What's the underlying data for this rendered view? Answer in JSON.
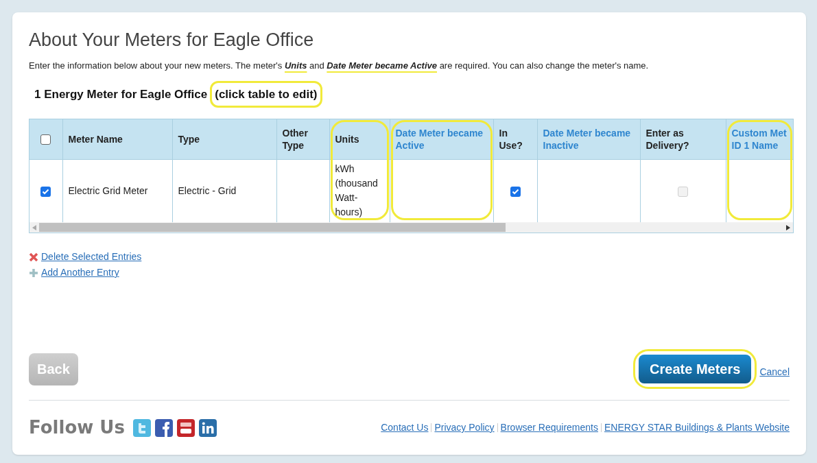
{
  "title": "About Your Meters for Eagle Office",
  "intro": "Enter the information below about your new meters. The meter's **Units** and **Date Meter became Active** are required. You can also change the meter's name.",
  "subtitle": {
    "text": "1 Energy Meter for Eagle Office",
    "note": "(click table to edit)",
    "note_highlighted": true
  },
  "table": {
    "select_all_checked": false,
    "columns": [
      {
        "label": "Meter Name",
        "link": false,
        "highlighted": false
      },
      {
        "label": "Type",
        "link": false,
        "highlighted": false
      },
      {
        "label": "Other Type",
        "link": false,
        "highlighted": false
      },
      {
        "label": "Units",
        "link": false,
        "highlighted": true
      },
      {
        "label": "Date Meter became Active",
        "link": true,
        "highlighted": true
      },
      {
        "label": "In Use?",
        "link": false,
        "highlighted": false
      },
      {
        "label": "Date Meter became Inactive",
        "link": true,
        "highlighted": false
      },
      {
        "label": "Enter as Delivery?",
        "link": false,
        "highlighted": false
      },
      {
        "label": "Custom Met ID 1 Name",
        "link": true,
        "highlighted": true
      }
    ],
    "rows": [
      {
        "selected": true,
        "cells": [
          {
            "kind": "text",
            "text": "Electric Grid Meter"
          },
          {
            "kind": "text",
            "text": "Electric - Grid"
          },
          {
            "kind": "empty"
          },
          {
            "kind": "text",
            "text": "kWh (thousand Watt-hours)"
          },
          {
            "kind": "empty"
          },
          {
            "kind": "checkbox",
            "checked": true,
            "disabled": false
          },
          {
            "kind": "empty"
          },
          {
            "kind": "checkbox",
            "checked": false,
            "disabled": true
          },
          {
            "kind": "empty"
          }
        ]
      }
    ]
  },
  "actions": [
    {
      "kind": "delete",
      "label": "Delete Selected Entries"
    },
    {
      "kind": "add",
      "label": "Add Another Entry"
    }
  ],
  "buttons": {
    "back": {
      "label": "Back",
      "disabled": true
    },
    "create": {
      "label": "Create Meters",
      "highlighted": true
    },
    "cancel": "Cancel"
  },
  "footer": {
    "follow": "Follow Us",
    "links": [
      "Contact Us",
      "Privacy Policy",
      "Browser Requirements",
      "ENERGY STAR Buildings & Plants Website"
    ]
  }
}
